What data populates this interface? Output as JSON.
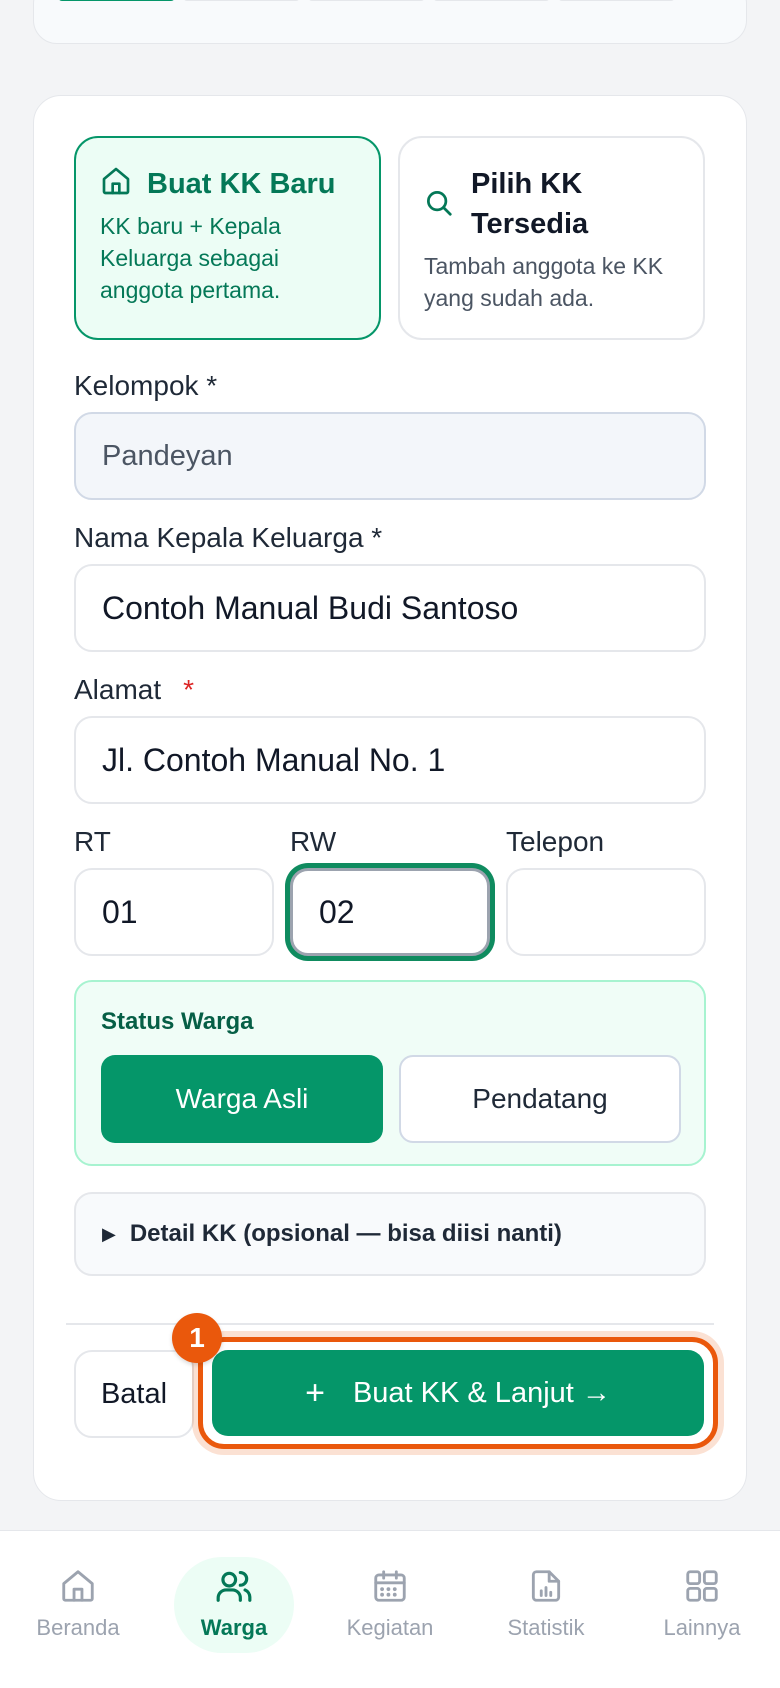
{
  "progress": {
    "total_steps": 5,
    "current_step": 1
  },
  "mode": {
    "new_kk": {
      "title": "Buat KK Baru",
      "desc": "KK baru + Kepala Keluarga sebagai anggota pertama."
    },
    "existing_kk": {
      "title": "Pilih KK Tersedia",
      "desc": "Tambah anggota ke KK yang sudah ada."
    }
  },
  "form": {
    "kelompok": {
      "label": "Kelompok *",
      "value": "Pandeyan"
    },
    "nama": {
      "label": "Nama Kepala Keluarga *",
      "value": "Contoh Manual Budi Santoso"
    },
    "alamat": {
      "label": "Alamat",
      "required_mark": "*",
      "value": "Jl. Contoh Manual No. 1"
    },
    "rt": {
      "label": "RT",
      "value": "01"
    },
    "rw": {
      "label": "RW",
      "value": "02"
    },
    "telepon": {
      "label": "Telepon",
      "value": ""
    }
  },
  "status": {
    "title": "Status Warga",
    "options": [
      "Warga Asli",
      "Pendatang"
    ],
    "selected": "Warga Asli"
  },
  "details_toggle": "Detail KK (opsional — bisa diisi nanti)",
  "actions": {
    "cancel": "Batal",
    "plus": "+",
    "primary": "Buat KK & Lanjut →",
    "step_badge": "1"
  },
  "colors": {
    "primary": "#059669",
    "highlight": "#ea580c"
  },
  "nav": {
    "items": [
      {
        "label": "Beranda",
        "icon": "home-icon"
      },
      {
        "label": "Warga",
        "icon": "users-icon"
      },
      {
        "label": "Kegiatan",
        "icon": "calendar-icon"
      },
      {
        "label": "Statistik",
        "icon": "report-icon"
      },
      {
        "label": "Lainnya",
        "icon": "grid-icon"
      }
    ],
    "active": "Warga"
  }
}
